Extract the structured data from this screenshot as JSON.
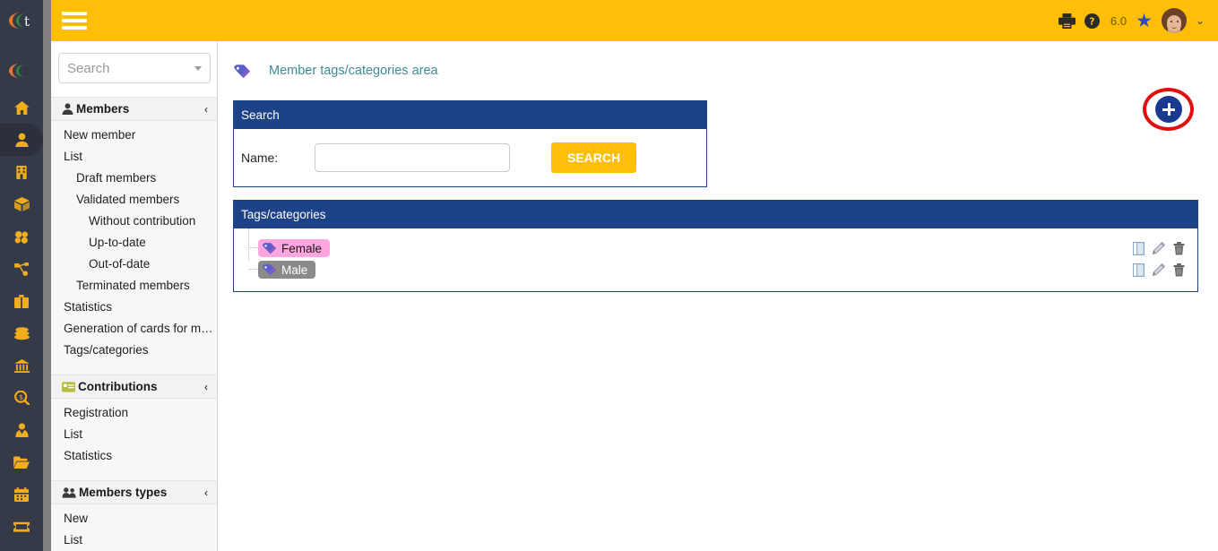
{
  "app": {
    "logo_name": "galette-logo",
    "rail_icons": [
      {
        "name": "home-icon"
      },
      {
        "name": "member-icon",
        "active": true
      },
      {
        "name": "building-icon"
      },
      {
        "name": "box-icon"
      },
      {
        "name": "cubes-icon"
      },
      {
        "name": "sitemap-icon"
      },
      {
        "name": "briefcase-icon"
      },
      {
        "name": "coins-icon"
      },
      {
        "name": "bank-icon"
      },
      {
        "name": "search-dollar-icon"
      },
      {
        "name": "user-tie-icon"
      },
      {
        "name": "folder-open-icon"
      },
      {
        "name": "calendar-icon"
      },
      {
        "name": "ticket-icon"
      }
    ]
  },
  "topbar": {
    "menu_toggle": "hamburger-icon",
    "print_icon": "printer-icon",
    "help_icon": "help-circle-icon",
    "version": "6.0",
    "star_icon": "star-icon",
    "avatar": "user-avatar",
    "chevron": "⌄"
  },
  "sidebar": {
    "search": {
      "placeholder": "Search",
      "value": ""
    },
    "groups": [
      {
        "label": "Members",
        "icon": "user-icon",
        "chevron": "‹",
        "items": [
          {
            "label": "New member",
            "level": 1
          },
          {
            "label": "List",
            "level": 1
          },
          {
            "label": "Draft members",
            "level": 2
          },
          {
            "label": "Validated members",
            "level": 2
          },
          {
            "label": "Without contribution",
            "level": 3
          },
          {
            "label": "Up-to-date",
            "level": 3
          },
          {
            "label": "Out-of-date",
            "level": 3
          },
          {
            "label": "Terminated members",
            "level": 2
          },
          {
            "label": "Statistics",
            "level": 1
          },
          {
            "label": "Generation of cards for me…",
            "level": 1
          },
          {
            "label": "Tags/categories",
            "level": 1
          }
        ]
      },
      {
        "label": "Contributions",
        "icon": "card-icon",
        "chevron": "‹",
        "items": [
          {
            "label": "Registration",
            "level": 1
          },
          {
            "label": "List",
            "level": 1
          },
          {
            "label": "Statistics",
            "level": 1
          }
        ]
      },
      {
        "label": "Members types",
        "icon": "users-icon",
        "chevron": "‹",
        "items": [
          {
            "label": "New",
            "level": 1
          },
          {
            "label": "List",
            "level": 1
          }
        ]
      }
    ]
  },
  "breadcrumb": {
    "icon": "tag-icon",
    "text": "Member tags/categories area"
  },
  "add_button": {
    "label": "+",
    "name": "add-tag-button",
    "highlighted": true,
    "highlight_color": "#e01010"
  },
  "search_panel": {
    "title": "Search",
    "name_label": "Name:",
    "name_value": "",
    "name_placeholder": "",
    "submit_label": "SEARCH"
  },
  "tags_panel": {
    "title": "Tags/categories",
    "rows": [
      {
        "label": "Female",
        "pill_bg": "#ffa6e0",
        "pill_fg": "#1a1a1a",
        "tag_icon": "tag-icon",
        "actions": [
          {
            "name": "detail-icon"
          },
          {
            "name": "edit-pencil-icon"
          },
          {
            "name": "delete-trash-icon"
          }
        ]
      },
      {
        "label": "Male",
        "pill_bg": "#8a8a8a",
        "pill_fg": "#ffffff",
        "tag_icon": "tag-icon",
        "actions": [
          {
            "name": "detail-icon"
          },
          {
            "name": "edit-pencil-icon"
          },
          {
            "name": "delete-trash-icon"
          }
        ]
      }
    ]
  },
  "colors": {
    "brand_yellow": "#ffbe08",
    "panel_blue": "#1e4287",
    "rail_dark": "#343a48",
    "link_teal": "#3d8b96",
    "accent_orange": "#f2ad1a"
  }
}
